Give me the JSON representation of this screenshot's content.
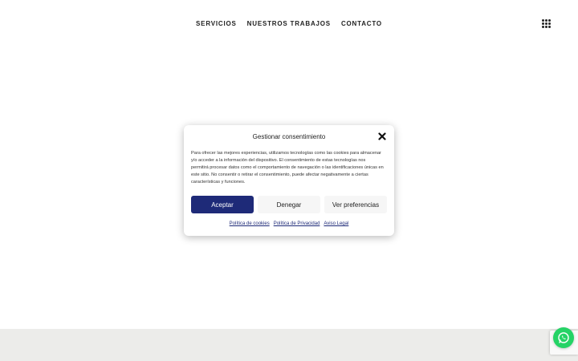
{
  "nav": {
    "items": [
      {
        "label": "SERVICIOS"
      },
      {
        "label": "NUESTROS TRABAJOS"
      },
      {
        "label": "CONTACTO"
      }
    ]
  },
  "consent": {
    "title": "Gestionar consentimiento",
    "body": "Para ofrecer las mejores experiencias, utilizamos tecnologías como las cookies para almacenar y/o acceder a la información del dispositivo. El consentimiento de estas tecnologías nos permitirá procesar datos como el comportamiento de navegación o las identificaciones únicas en este sitio. No consentir o retirar el consentimiento, puede afectar negativamente a ciertas características y funciones.",
    "accept_label": "Aceptar",
    "deny_label": "Denegar",
    "prefs_label": "Ver preferencias",
    "links": [
      {
        "label": "Política de cookies"
      },
      {
        "label": "Política de Privacidad"
      },
      {
        "label": "Aviso Legal"
      }
    ]
  },
  "colors": {
    "accent": "#1e2a78",
    "whatsapp": "#25d366",
    "footer": "#ececea"
  },
  "icons": {
    "menu": "grid-menu-icon",
    "close": "close-icon",
    "whatsapp": "whatsapp-icon"
  }
}
